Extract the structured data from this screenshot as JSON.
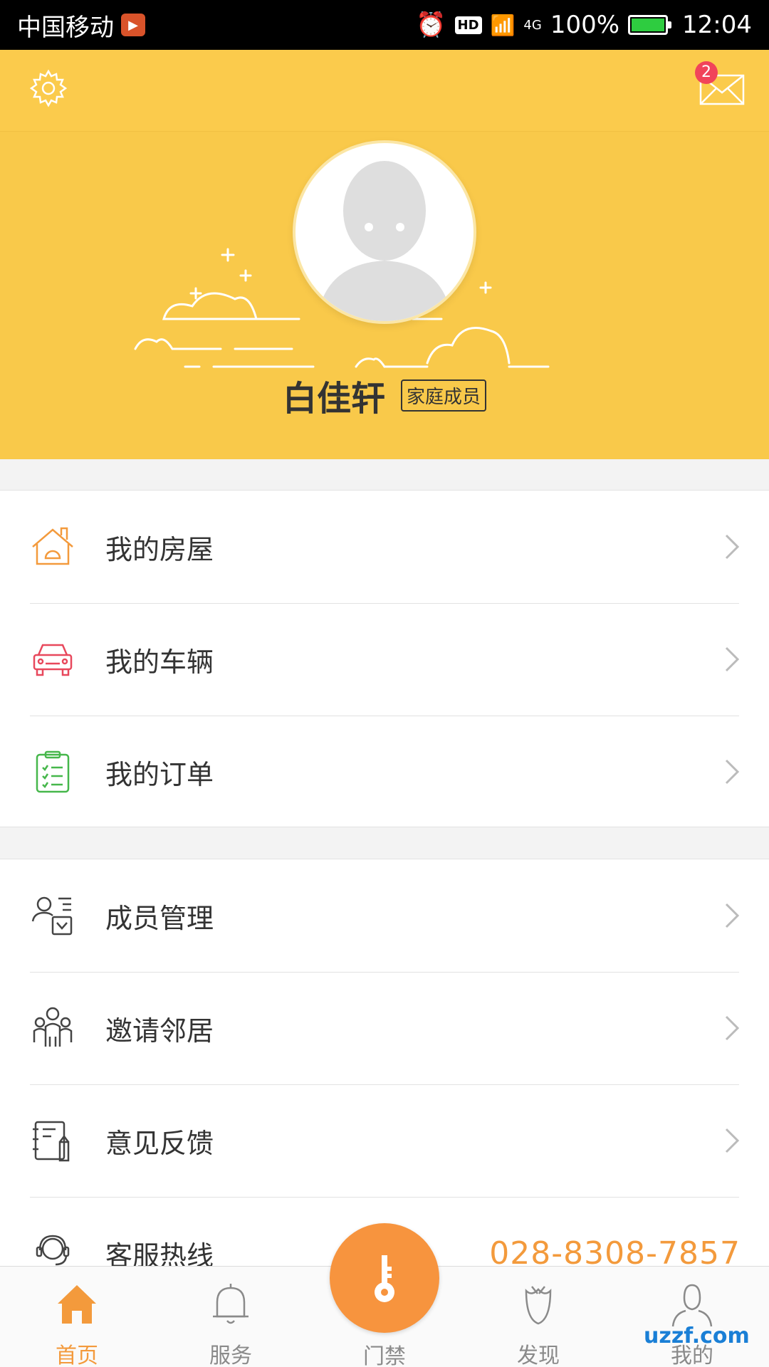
{
  "status_bar": {
    "carrier": "中国移动",
    "hd": "HD",
    "network": "4G",
    "battery": "100%",
    "time": "12:04"
  },
  "header": {
    "mail_badge": "2",
    "user_name": "白佳轩",
    "role": "家庭成员"
  },
  "menu_group1": [
    {
      "label": "我的房屋",
      "icon": "house-icon"
    },
    {
      "label": "我的车辆",
      "icon": "car-icon"
    },
    {
      "label": "我的订单",
      "icon": "order-list-icon"
    }
  ],
  "menu_group2": [
    {
      "label": "成员管理",
      "icon": "member-manage-icon"
    },
    {
      "label": "邀请邻居",
      "icon": "invite-neighbor-icon"
    },
    {
      "label": "意见反馈",
      "icon": "feedback-icon"
    },
    {
      "label": "客服热线",
      "icon": "customer-service-icon",
      "value": "028-8308-7857"
    }
  ],
  "tabbar": {
    "home": "首页",
    "service": "服务",
    "door": "门禁",
    "discover": "发现",
    "me": "我的"
  },
  "colors": {
    "header_yellow": "#f9c94a",
    "accent_orange": "#f7943e",
    "phone_orange": "#f39a3c"
  },
  "watermark": "uzzf.com"
}
